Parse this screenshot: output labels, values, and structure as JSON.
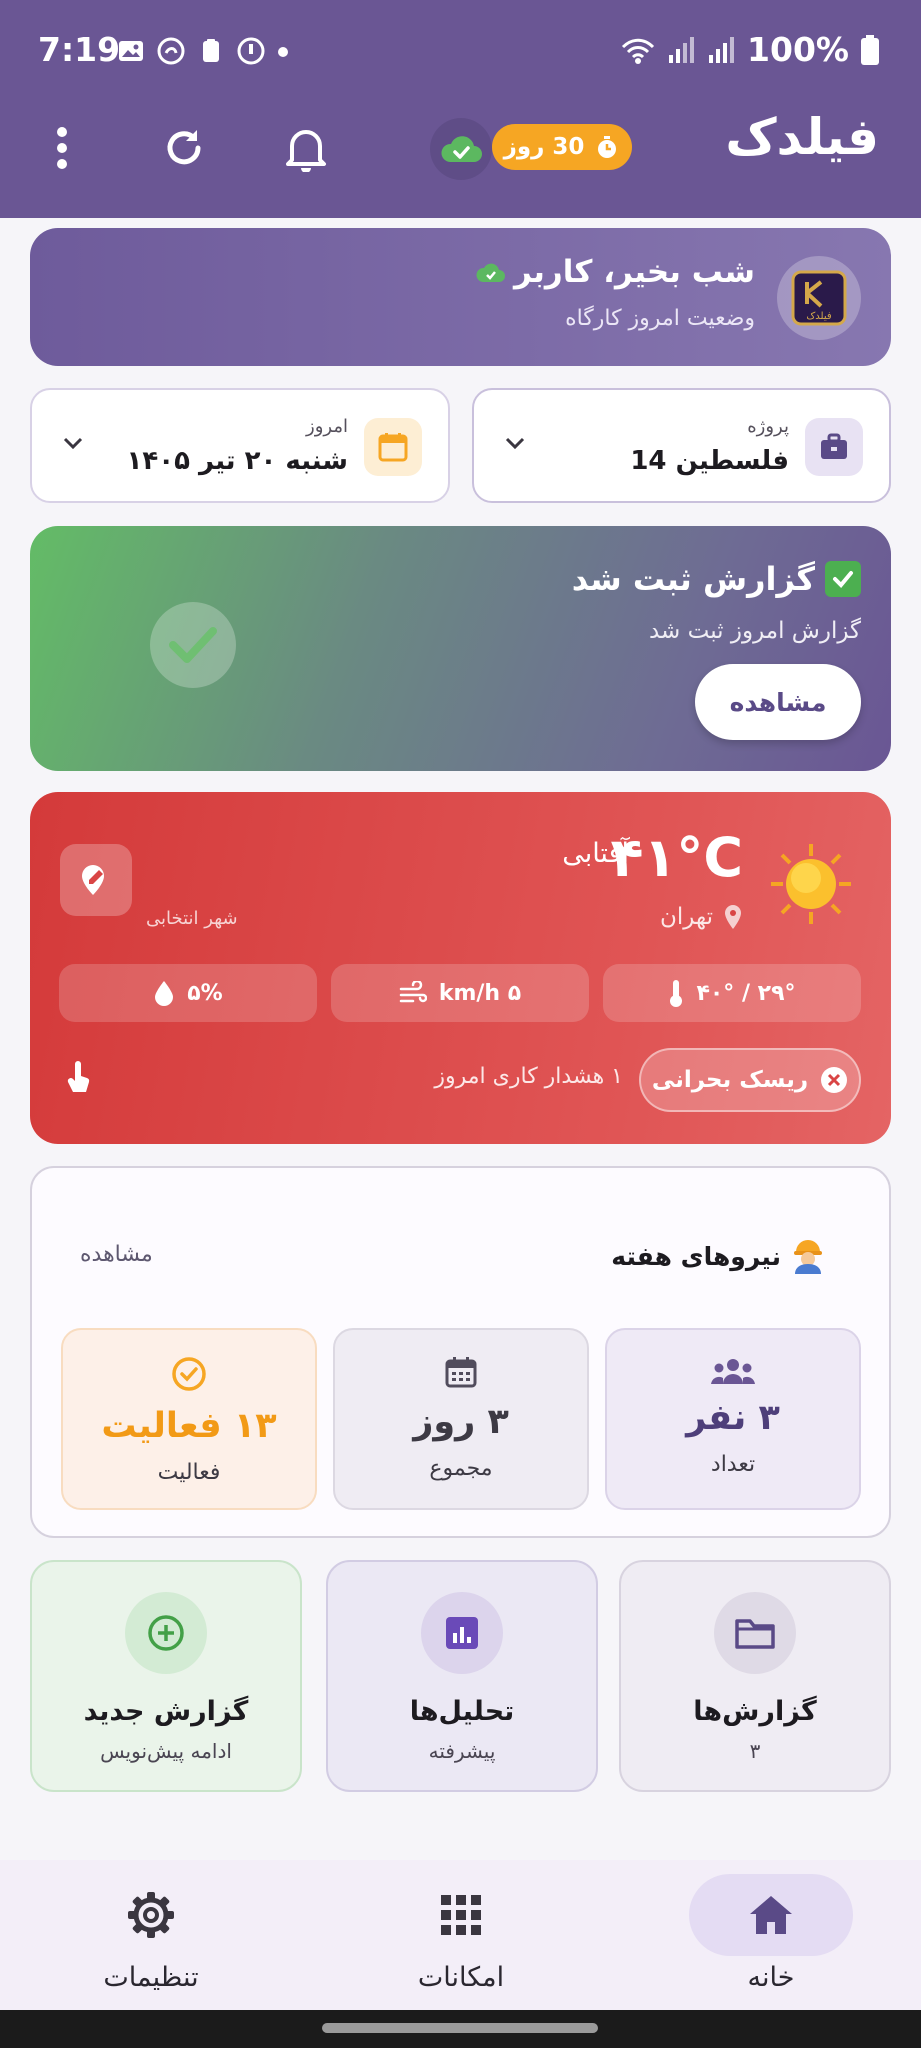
{
  "status_bar": {
    "time": "7:19",
    "battery": "100%"
  },
  "app_bar": {
    "title": "فیلدک",
    "trial_badge": "30 روز"
  },
  "greeting": {
    "title": "شب بخیر، کاربر",
    "subtitle": "وضعیت امروز کارگاه",
    "logo_text": "فیلدک"
  },
  "project_selector": {
    "label": "پروژه",
    "value": "فلسطین 14"
  },
  "date_selector": {
    "label": "امروز",
    "value": "شنبه ۲۰ تیر ۱۴۰۵"
  },
  "report": {
    "title": "گزارش ثبت شد",
    "subtitle": "گزارش امروز ثبت شد",
    "button": "مشاهده"
  },
  "weather": {
    "temperature": "۴۱°C",
    "condition": "آفتابی",
    "city": "تهران",
    "city_label": "شهر انتخابی",
    "temp_range": "۴۰° / ۲۹°",
    "wind": "km/h ۵",
    "humidity": "۵%",
    "risk_badge": "ریسک بحرانی",
    "warning_text": "۱ هشدار کاری امروز"
  },
  "workforce": {
    "title": "نیروهای هفته",
    "view_link": "مشاهده",
    "stats": [
      {
        "value": "۳ نفر",
        "label": "تعداد"
      },
      {
        "value": "۳ روز",
        "label": "مجموع"
      },
      {
        "value": "۱۳ فعالیت",
        "label": "فعالیت"
      }
    ]
  },
  "tiles": [
    {
      "title": "گزارش‌ها",
      "subtitle": "۳"
    },
    {
      "title": "تحلیل‌ها",
      "subtitle": "پیشرفته"
    },
    {
      "title": "گزارش جدید",
      "subtitle": "ادامه پیش‌نویس"
    }
  ],
  "bottom_nav": [
    {
      "label": "خانه"
    },
    {
      "label": "امکانات"
    },
    {
      "label": "تنظیمات"
    }
  ],
  "colors": {
    "primary": "#6a5694",
    "accent_orange": "#f6a623",
    "weather_red": "#d43a3a",
    "success_green": "#4caf50"
  }
}
